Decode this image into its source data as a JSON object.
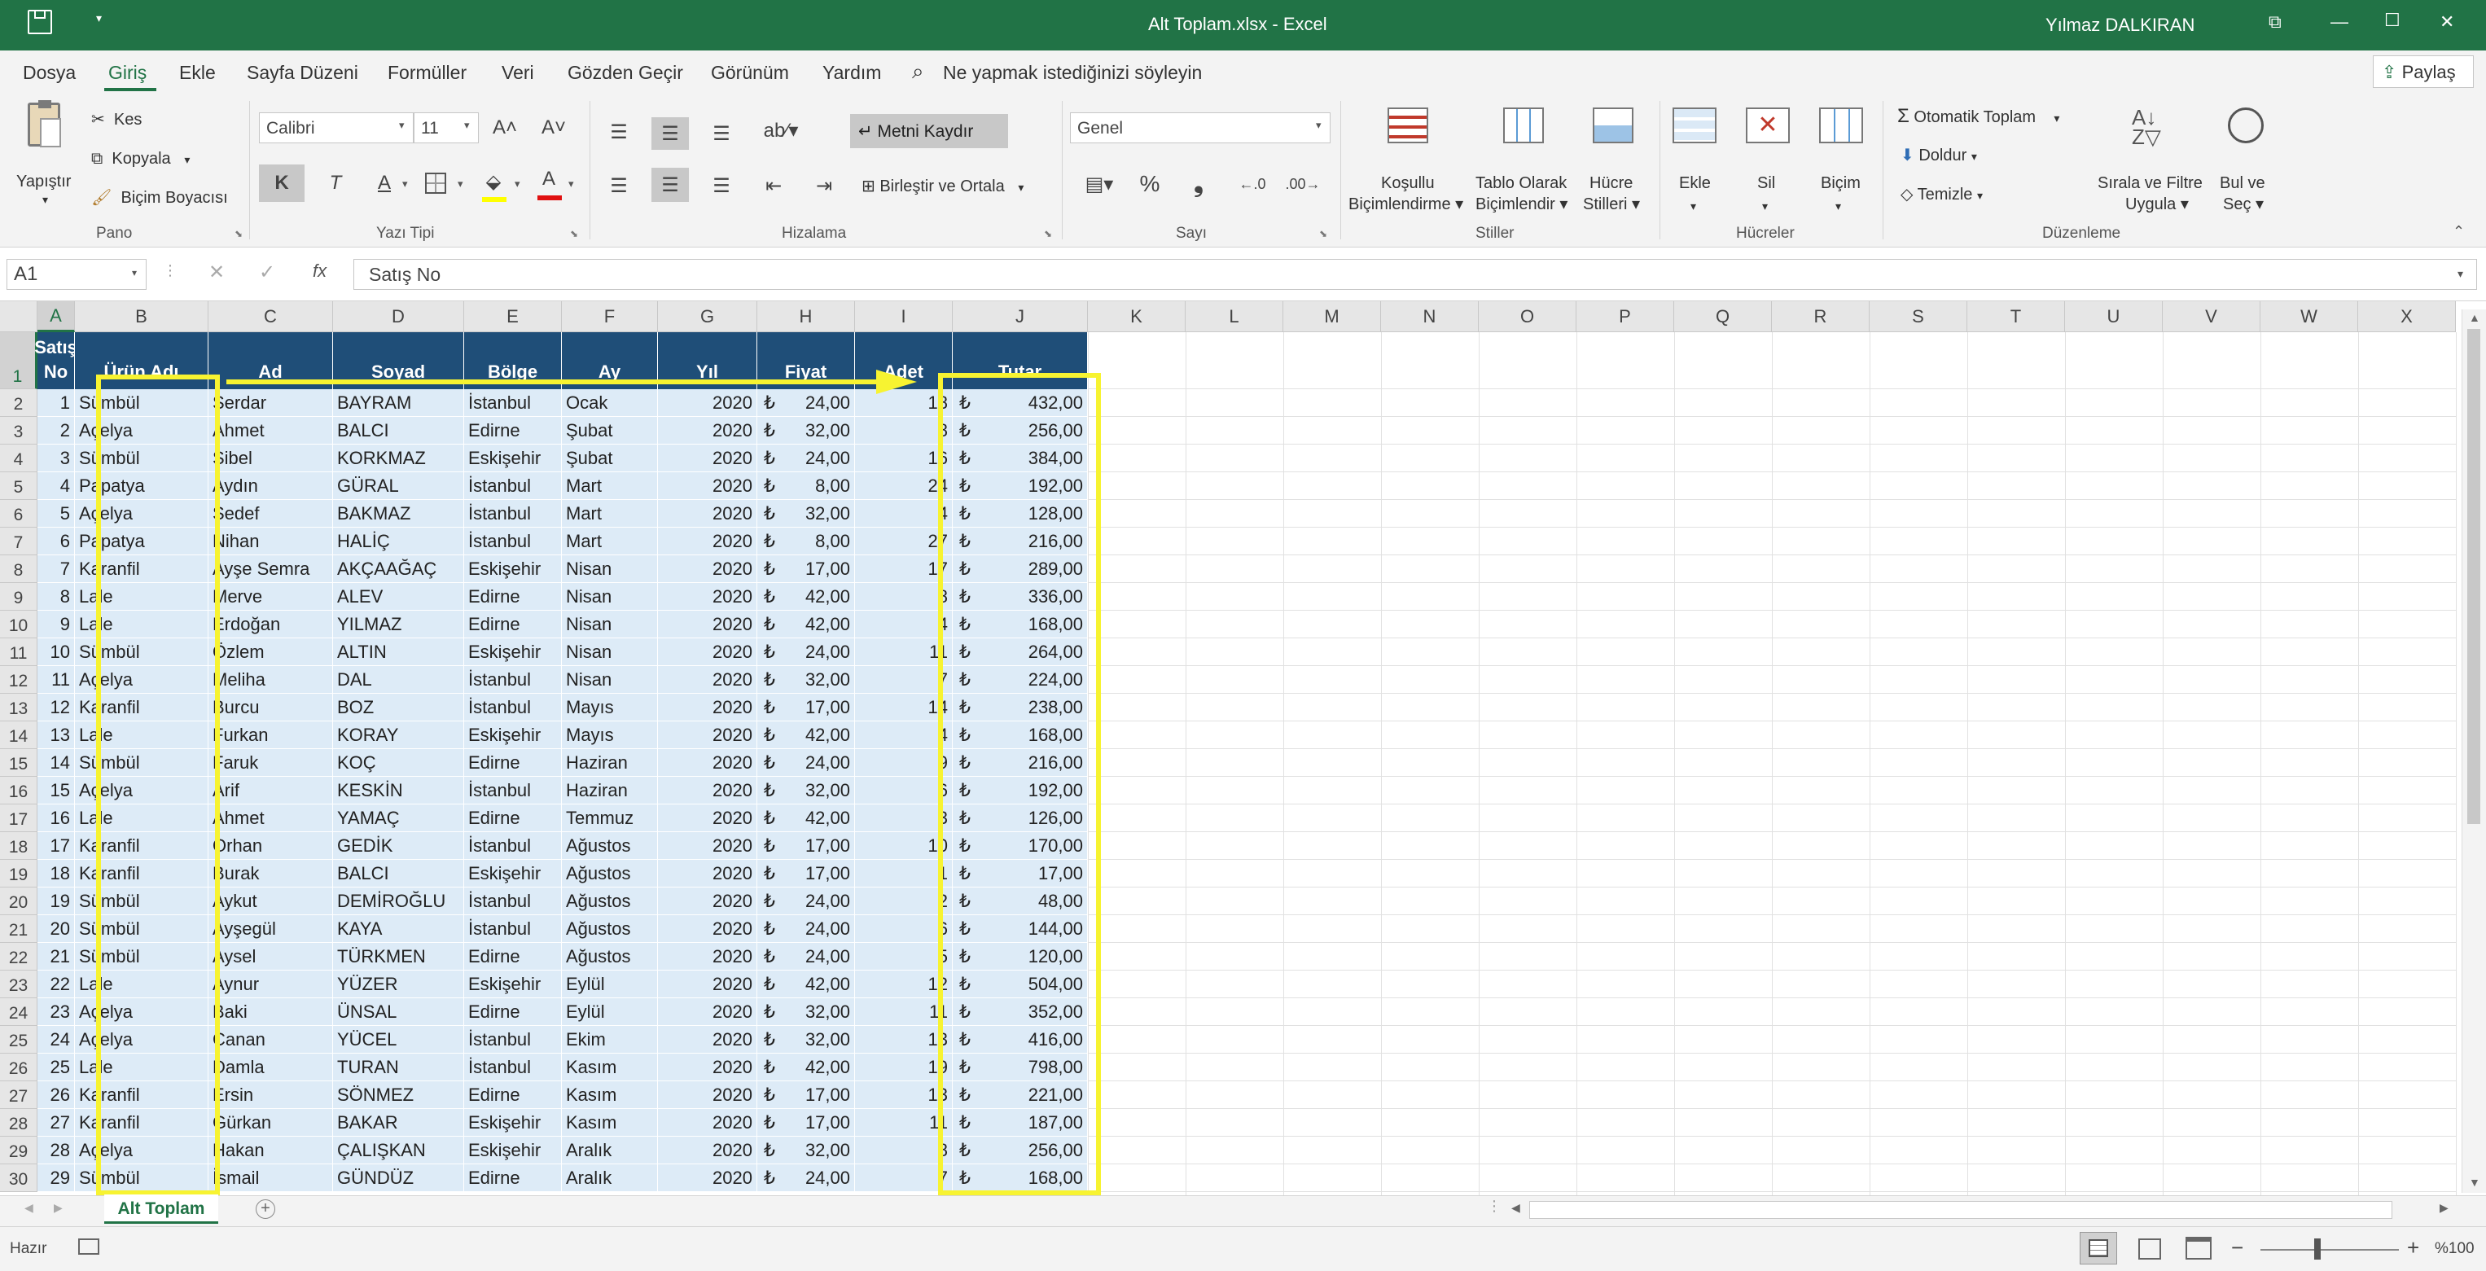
{
  "window": {
    "title": "Alt Toplam.xlsx  -  Excel",
    "user": "Yılmaz DALKIRAN",
    "controls": {
      "ribbon_opts": "⧉",
      "minimize": "—",
      "maximize": "☐",
      "close": "✕"
    }
  },
  "menu": {
    "items": [
      "Dosya",
      "Giriş",
      "Ekle",
      "Sayfa Düzeni",
      "Formüller",
      "Veri",
      "Gözden Geçir",
      "Görünüm",
      "Yardım"
    ],
    "active": "Giriş",
    "search_text": "Ne yapmak istediğinizi söyleyin",
    "share": "Paylaş"
  },
  "ribbon": {
    "pano": {
      "paste": "Yapıştır",
      "cut": "Kes",
      "copy": "Kopyala",
      "format_painter": "Biçim Boyacısı",
      "label": "Pano"
    },
    "font": {
      "name": "Calibri",
      "size": "11",
      "grow": "A˄",
      "shrink": "A˅",
      "bold": "K",
      "italic": "T",
      "underline": "A",
      "font_color": "A",
      "label": "Yazı Tipi"
    },
    "align": {
      "wrap": "Metni Kaydır",
      "merge": "Birleştir ve Ortala",
      "label": "Hizalama"
    },
    "number": {
      "format": "Genel",
      "percent": "%",
      "comma": "❟",
      "label": "Sayı"
    },
    "styles": {
      "cond": [
        "Koşullu",
        "Biçimlendirme ▾"
      ],
      "table": [
        "Tablo Olarak",
        "Biçimlendir ▾"
      ],
      "cell": [
        "Hücre",
        "Stilleri ▾"
      ],
      "label": "Stiller"
    },
    "cells": {
      "insert": "Ekle",
      "delete": "Sil",
      "format": "Biçim",
      "label": "Hücreler"
    },
    "edit": {
      "autosum": "Otomatik Toplam",
      "fill": "Doldur",
      "clear": "Temizle",
      "sort": [
        "Sırala ve Filtre",
        "Uygula ▾"
      ],
      "find": [
        "Bul ve",
        "Seç ▾"
      ],
      "label": "Düzenleme"
    }
  },
  "formula_bar": {
    "name_box": "A1",
    "fx": "fx",
    "value": "Satış No"
  },
  "columns": [
    "A",
    "B",
    "C",
    "D",
    "E",
    "F",
    "G",
    "H",
    "I",
    "J",
    "K",
    "L",
    "M",
    "N",
    "O",
    "P",
    "Q",
    "R",
    "S",
    "T",
    "U",
    "V",
    "W",
    "X"
  ],
  "headers": [
    "Satış No",
    "Ürün Adı",
    "Ad",
    "Soyad",
    "Bölge",
    "Ay",
    "Yıl",
    "Fiyat",
    "Adet",
    "Tutar"
  ],
  "currency": "₺",
  "rows": [
    [
      "1",
      "Sümbül",
      "Serdar",
      "BAYRAM",
      "İstanbul",
      "Ocak",
      "2020",
      "24,00",
      "18",
      "432,00"
    ],
    [
      "2",
      "Açelya",
      "Ahmet",
      "BALCI",
      "Edirne",
      "Şubat",
      "2020",
      "32,00",
      "8",
      "256,00"
    ],
    [
      "3",
      "Sümbül",
      "Sibel",
      "KORKMAZ",
      "Eskişehir",
      "Şubat",
      "2020",
      "24,00",
      "16",
      "384,00"
    ],
    [
      "4",
      "Papatya",
      "Aydın",
      "GÜRAL",
      "İstanbul",
      "Mart",
      "2020",
      "8,00",
      "24",
      "192,00"
    ],
    [
      "5",
      "Açelya",
      "Sedef",
      "BAKMAZ",
      "İstanbul",
      "Mart",
      "2020",
      "32,00",
      "4",
      "128,00"
    ],
    [
      "6",
      "Papatya",
      "Nihan",
      "HALİÇ",
      "İstanbul",
      "Mart",
      "2020",
      "8,00",
      "27",
      "216,00"
    ],
    [
      "7",
      "Karanfil",
      "Ayşe Semra",
      "AKÇAAĞAÇ",
      "Eskişehir",
      "Nisan",
      "2020",
      "17,00",
      "17",
      "289,00"
    ],
    [
      "8",
      "Lale",
      "Merve",
      "ALEV",
      "Edirne",
      "Nisan",
      "2020",
      "42,00",
      "8",
      "336,00"
    ],
    [
      "9",
      "Lale",
      "Erdoğan",
      "YILMAZ",
      "Edirne",
      "Nisan",
      "2020",
      "42,00",
      "4",
      "168,00"
    ],
    [
      "10",
      "Sümbül",
      "Özlem",
      "ALTIN",
      "Eskişehir",
      "Nisan",
      "2020",
      "24,00",
      "11",
      "264,00"
    ],
    [
      "11",
      "Açelya",
      "Meliha",
      "DAL",
      "İstanbul",
      "Nisan",
      "2020",
      "32,00",
      "7",
      "224,00"
    ],
    [
      "12",
      "Karanfil",
      "Burcu",
      "BOZ",
      "İstanbul",
      "Mayıs",
      "2020",
      "17,00",
      "14",
      "238,00"
    ],
    [
      "13",
      "Lale",
      "Furkan",
      "KORAY",
      "Eskişehir",
      "Mayıs",
      "2020",
      "42,00",
      "4",
      "168,00"
    ],
    [
      "14",
      "Sümbül",
      "Faruk",
      "KOÇ",
      "Edirne",
      "Haziran",
      "2020",
      "24,00",
      "9",
      "216,00"
    ],
    [
      "15",
      "Açelya",
      "Arif",
      "KESKİN",
      "İstanbul",
      "Haziran",
      "2020",
      "32,00",
      "6",
      "192,00"
    ],
    [
      "16",
      "Lale",
      "Ahmet",
      "YAMAÇ",
      "Edirne",
      "Temmuz",
      "2020",
      "42,00",
      "3",
      "126,00"
    ],
    [
      "17",
      "Karanfil",
      "Orhan",
      "GEDİK",
      "İstanbul",
      "Ağustos",
      "2020",
      "17,00",
      "10",
      "170,00"
    ],
    [
      "18",
      "Karanfil",
      "Burak",
      "BALCI",
      "Eskişehir",
      "Ağustos",
      "2020",
      "17,00",
      "1",
      "17,00"
    ],
    [
      "19",
      "Sümbül",
      "Aykut",
      "DEMİROĞLU",
      "İstanbul",
      "Ağustos",
      "2020",
      "24,00",
      "2",
      "48,00"
    ],
    [
      "20",
      "Sümbül",
      "Ayşegül",
      "KAYA",
      "İstanbul",
      "Ağustos",
      "2020",
      "24,00",
      "6",
      "144,00"
    ],
    [
      "21",
      "Sümbül",
      "Aysel",
      "TÜRKMEN",
      "Edirne",
      "Ağustos",
      "2020",
      "24,00",
      "5",
      "120,00"
    ],
    [
      "22",
      "Lale",
      "Aynur",
      "YÜZER",
      "Eskişehir",
      "Eylül",
      "2020",
      "42,00",
      "12",
      "504,00"
    ],
    [
      "23",
      "Açelya",
      "Baki",
      "ÜNSAL",
      "Edirne",
      "Eylül",
      "2020",
      "32,00",
      "11",
      "352,00"
    ],
    [
      "24",
      "Açelya",
      "Canan",
      "YÜCEL",
      "İstanbul",
      "Ekim",
      "2020",
      "32,00",
      "13",
      "416,00"
    ],
    [
      "25",
      "Lale",
      "Damla",
      "TURAN",
      "İstanbul",
      "Kasım",
      "2020",
      "42,00",
      "19",
      "798,00"
    ],
    [
      "26",
      "Karanfil",
      "Ersin",
      "SÖNMEZ",
      "Edirne",
      "Kasım",
      "2020",
      "17,00",
      "13",
      "221,00"
    ],
    [
      "27",
      "Karanfil",
      "Gürkan",
      "BAKAR",
      "Eskişehir",
      "Kasım",
      "2020",
      "17,00",
      "11",
      "187,00"
    ],
    [
      "28",
      "Açelya",
      "Hakan",
      "ÇALIŞKAN",
      "Eskişehir",
      "Aralık",
      "2020",
      "32,00",
      "8",
      "256,00"
    ],
    [
      "29",
      "Sümbül",
      "İsmail",
      "GÜNDÜZ",
      "Edirne",
      "Aralık",
      "2020",
      "24,00",
      "7",
      "168,00"
    ]
  ],
  "sheet_tab": "Alt Toplam",
  "status": {
    "ready": "Hazır",
    "zoom": "%100"
  }
}
